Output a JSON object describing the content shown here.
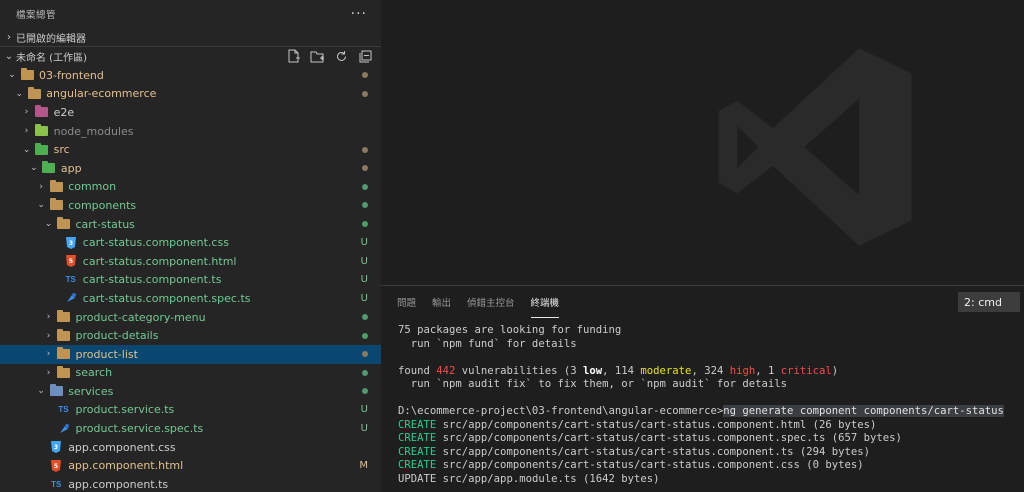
{
  "sidebar": {
    "title": "檔案總管",
    "more": "···",
    "open_editors": "已開啟的編輯器",
    "workspace": "未命名 (工作區)",
    "tree": [
      {
        "label": "03-frontend",
        "depth": 0,
        "chev": "⌄",
        "kind": "folder-special",
        "color": "#e2c08d",
        "deco": "dot",
        "deco_color": "#8c7a5e"
      },
      {
        "label": "angular-ecommerce",
        "depth": 1,
        "chev": "⌄",
        "kind": "folder",
        "color": "#e2c08d",
        "deco": "dot",
        "deco_color": "#8c7a5e"
      },
      {
        "label": "e2e",
        "depth": 2,
        "chev": "›",
        "kind": "folder-e2e",
        "color": "#cccccc",
        "deco": "",
        "deco_color": ""
      },
      {
        "label": "node_modules",
        "depth": 2,
        "chev": "›",
        "kind": "folder-node",
        "color": "#8c8c8c",
        "deco": "",
        "deco_color": ""
      },
      {
        "label": "src",
        "depth": 2,
        "chev": "⌄",
        "kind": "folder-src",
        "color": "#e2c08d",
        "deco": "dot",
        "deco_color": "#8c7a5e"
      },
      {
        "label": "app",
        "depth": 3,
        "chev": "⌄",
        "kind": "folder-app",
        "color": "#e2c08d",
        "deco": "dot",
        "deco_color": "#8c7a5e"
      },
      {
        "label": "common",
        "depth": 4,
        "chev": "›",
        "kind": "folder",
        "color": "#73c991",
        "deco": "dot",
        "deco_color": "#4e9a6a"
      },
      {
        "label": "components",
        "depth": 4,
        "chev": "⌄",
        "kind": "folder",
        "color": "#73c991",
        "deco": "dot",
        "deco_color": "#4e9a6a"
      },
      {
        "label": "cart-status",
        "depth": 5,
        "chev": "⌄",
        "kind": "folder",
        "color": "#73c991",
        "deco": "dot",
        "deco_color": "#4e9a6a"
      },
      {
        "label": "cart-status.component.css",
        "depth": 6,
        "chev": "",
        "kind": "css",
        "color": "#73c991",
        "deco": "U",
        "deco_color": "#73c991"
      },
      {
        "label": "cart-status.component.html",
        "depth": 6,
        "chev": "",
        "kind": "html",
        "color": "#73c991",
        "deco": "U",
        "deco_color": "#73c991"
      },
      {
        "label": "cart-status.component.ts",
        "depth": 6,
        "chev": "",
        "kind": "ts",
        "color": "#73c991",
        "deco": "U",
        "deco_color": "#73c991"
      },
      {
        "label": "cart-status.component.spec.ts",
        "depth": 6,
        "chev": "",
        "kind": "spec",
        "color": "#73c991",
        "deco": "U",
        "deco_color": "#73c991"
      },
      {
        "label": "product-category-menu",
        "depth": 5,
        "chev": "›",
        "kind": "folder",
        "color": "#73c991",
        "deco": "dot",
        "deco_color": "#4e9a6a"
      },
      {
        "label": "product-details",
        "depth": 5,
        "chev": "›",
        "kind": "folder",
        "color": "#73c991",
        "deco": "dot",
        "deco_color": "#4e9a6a"
      },
      {
        "label": "product-list",
        "depth": 5,
        "chev": "›",
        "kind": "folder",
        "color": "#e2c08d",
        "deco": "dot",
        "deco_color": "#8c7a5e",
        "selected": true
      },
      {
        "label": "search",
        "depth": 5,
        "chev": "›",
        "kind": "folder",
        "color": "#73c991",
        "deco": "dot",
        "deco_color": "#4e9a6a"
      },
      {
        "label": "services",
        "depth": 4,
        "chev": "⌄",
        "kind": "folder-services",
        "color": "#73c991",
        "deco": "dot",
        "deco_color": "#4e9a6a"
      },
      {
        "label": "product.service.ts",
        "depth": 5,
        "chev": "",
        "kind": "ts",
        "color": "#73c991",
        "deco": "U",
        "deco_color": "#73c991"
      },
      {
        "label": "product.service.spec.ts",
        "depth": 5,
        "chev": "",
        "kind": "spec",
        "color": "#73c991",
        "deco": "U",
        "deco_color": "#73c991"
      },
      {
        "label": "app.component.css",
        "depth": 4,
        "chev": "",
        "kind": "css",
        "color": "#cccccc",
        "deco": "",
        "deco_color": ""
      },
      {
        "label": "app.component.html",
        "depth": 4,
        "chev": "",
        "kind": "html",
        "color": "#e2c08d",
        "deco": "M",
        "deco_color": "#e2c08d"
      },
      {
        "label": "app.component.ts",
        "depth": 4,
        "chev": "",
        "kind": "ts",
        "color": "#cccccc",
        "deco": "",
        "deco_color": ""
      }
    ]
  },
  "panel": {
    "tabs": [
      "問題",
      "輸出",
      "偵錯主控台",
      "終端機"
    ],
    "active_tab": 3,
    "terminal_select": "2: cmd",
    "terminal_lines": [
      [
        {
          "t": "75 packages are looking for funding"
        }
      ],
      [
        {
          "t": "  run `npm fund` for details"
        }
      ],
      [
        {
          "t": ""
        }
      ],
      [
        {
          "t": "found "
        },
        {
          "t": "442",
          "c": "c-red"
        },
        {
          "t": " vulnerabilities (3 "
        },
        {
          "t": "low",
          "c": "c-bold"
        },
        {
          "t": ", 114 "
        },
        {
          "t": "moderate",
          "c": "c-yel"
        },
        {
          "t": ", 324 "
        },
        {
          "t": "high",
          "c": "c-red"
        },
        {
          "t": ", 1 "
        },
        {
          "t": "critical",
          "c": "c-red"
        },
        {
          "t": ")"
        }
      ],
      [
        {
          "t": "  run `npm audit fix` to fix them, or `npm audit` for details"
        }
      ],
      [
        {
          "t": ""
        }
      ],
      [
        {
          "t": "D:\\ecommerce-project\\03-frontend\\angular-ecommerce>"
        },
        {
          "t": "ng generate component components/cart-status",
          "c": "cmd-hl"
        }
      ],
      [
        {
          "t": "CREATE",
          "c": "c-grn"
        },
        {
          "t": " src/app/components/cart-status/cart-status.component.html (26 bytes)"
        }
      ],
      [
        {
          "t": "CREATE",
          "c": "c-grn"
        },
        {
          "t": " src/app/components/cart-status/cart-status.component.spec.ts (657 bytes)"
        }
      ],
      [
        {
          "t": "CREATE",
          "c": "c-grn"
        },
        {
          "t": " src/app/components/cart-status/cart-status.component.ts (294 bytes)"
        }
      ],
      [
        {
          "t": "CREATE",
          "c": "c-grn"
        },
        {
          "t": " src/app/components/cart-status/cart-status.component.css (0 bytes)"
        }
      ],
      [
        {
          "t": "UPDATE"
        },
        {
          "t": " src/app/app.module.ts (1642 bytes)"
        }
      ]
    ]
  }
}
